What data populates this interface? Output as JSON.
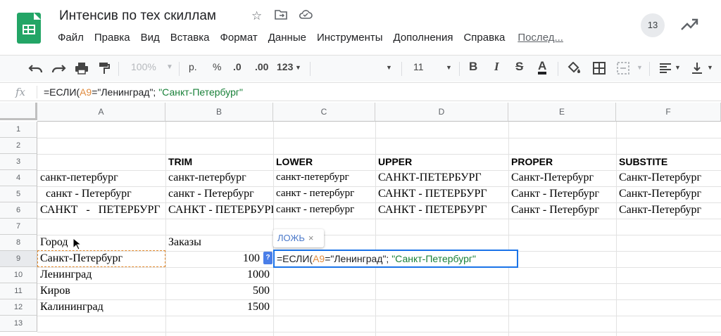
{
  "app": {
    "title": "Интенсив  по тех скиллам",
    "menu": [
      "Файл",
      "Правка",
      "Вид",
      "Вставка",
      "Формат",
      "Данные",
      "Инструменты",
      "Дополнения",
      "Справка"
    ],
    "last_edit": "Послед...",
    "avatar_count": "13",
    "icons": [
      "star-icon",
      "move-to-folder-icon",
      "cloud-saved-icon",
      "trend-icon"
    ],
    "colors": {
      "logo": "#23a566",
      "accent": "#1a73e8",
      "ref": "#e08b3e",
      "string": "#188038",
      "hint": "#4a78c9"
    }
  },
  "toolbar": {
    "zoom": "100%",
    "currency": "р.",
    "percent": "%",
    "dec_decrease": ".0",
    "dec_increase": ".00",
    "format_more": "123",
    "font_size": "11",
    "bold": "B",
    "italic": "I",
    "strike": "S",
    "text_color": "A"
  },
  "formula_bar": {
    "fx": "fx",
    "prefix": "=ЕСЛИ(",
    "ref": "A9",
    "mid": "=\"Ленинград\"; ",
    "str2": "\"Санкт-Петербург\""
  },
  "editor": {
    "tooltip": "ЛОЖЬ",
    "close": "×",
    "help": "?",
    "prefix": "=ЕСЛИ(",
    "ref": "A9",
    "mid": "=\"Ленинград\"; ",
    "str2": "\"Санкт-Петербург\""
  },
  "sheet": {
    "columns": [
      "A",
      "B",
      "C",
      "D",
      "E",
      "F"
    ],
    "rows": [
      "1",
      "2",
      "3",
      "4",
      "5",
      "6",
      "7",
      "8",
      "9",
      "10",
      "11",
      "12",
      "13"
    ],
    "headers_row3": [
      "TRIM",
      "LOWER",
      "UPPER",
      "PROPER",
      "SUBSTITE"
    ],
    "data_rows": [
      [
        "санкт-петербург",
        "санкт-петербург",
        "санкт-петербург",
        "САНКТ-ПЕТЕРБУРГ",
        "Санкт-Петербург",
        "Санкт-Петербург"
      ],
      [
        "  санкт - Петербург",
        "санкт - Петербург",
        "санкт - петербург",
        "САНКТ - ПЕТЕРБУРГ",
        "Санкт - Петербург",
        "Санкт-Петербург"
      ],
      [
        "САНКТ   -   ПЕТЕРБУРГ",
        "САНКТ - ПЕТЕРБУРГ",
        "санкт - петербург",
        "САНКТ - ПЕТЕРБУРГ",
        "Санкт - Петербург",
        "Санкт-Петербург"
      ]
    ],
    "city_header": "Город",
    "orders_header": "Заказы",
    "cities": [
      "Санкт-Петербург",
      "Ленинград",
      "Киров",
      "Калининград"
    ],
    "orders": [
      "100",
      "1000",
      "500",
      "1500"
    ]
  }
}
